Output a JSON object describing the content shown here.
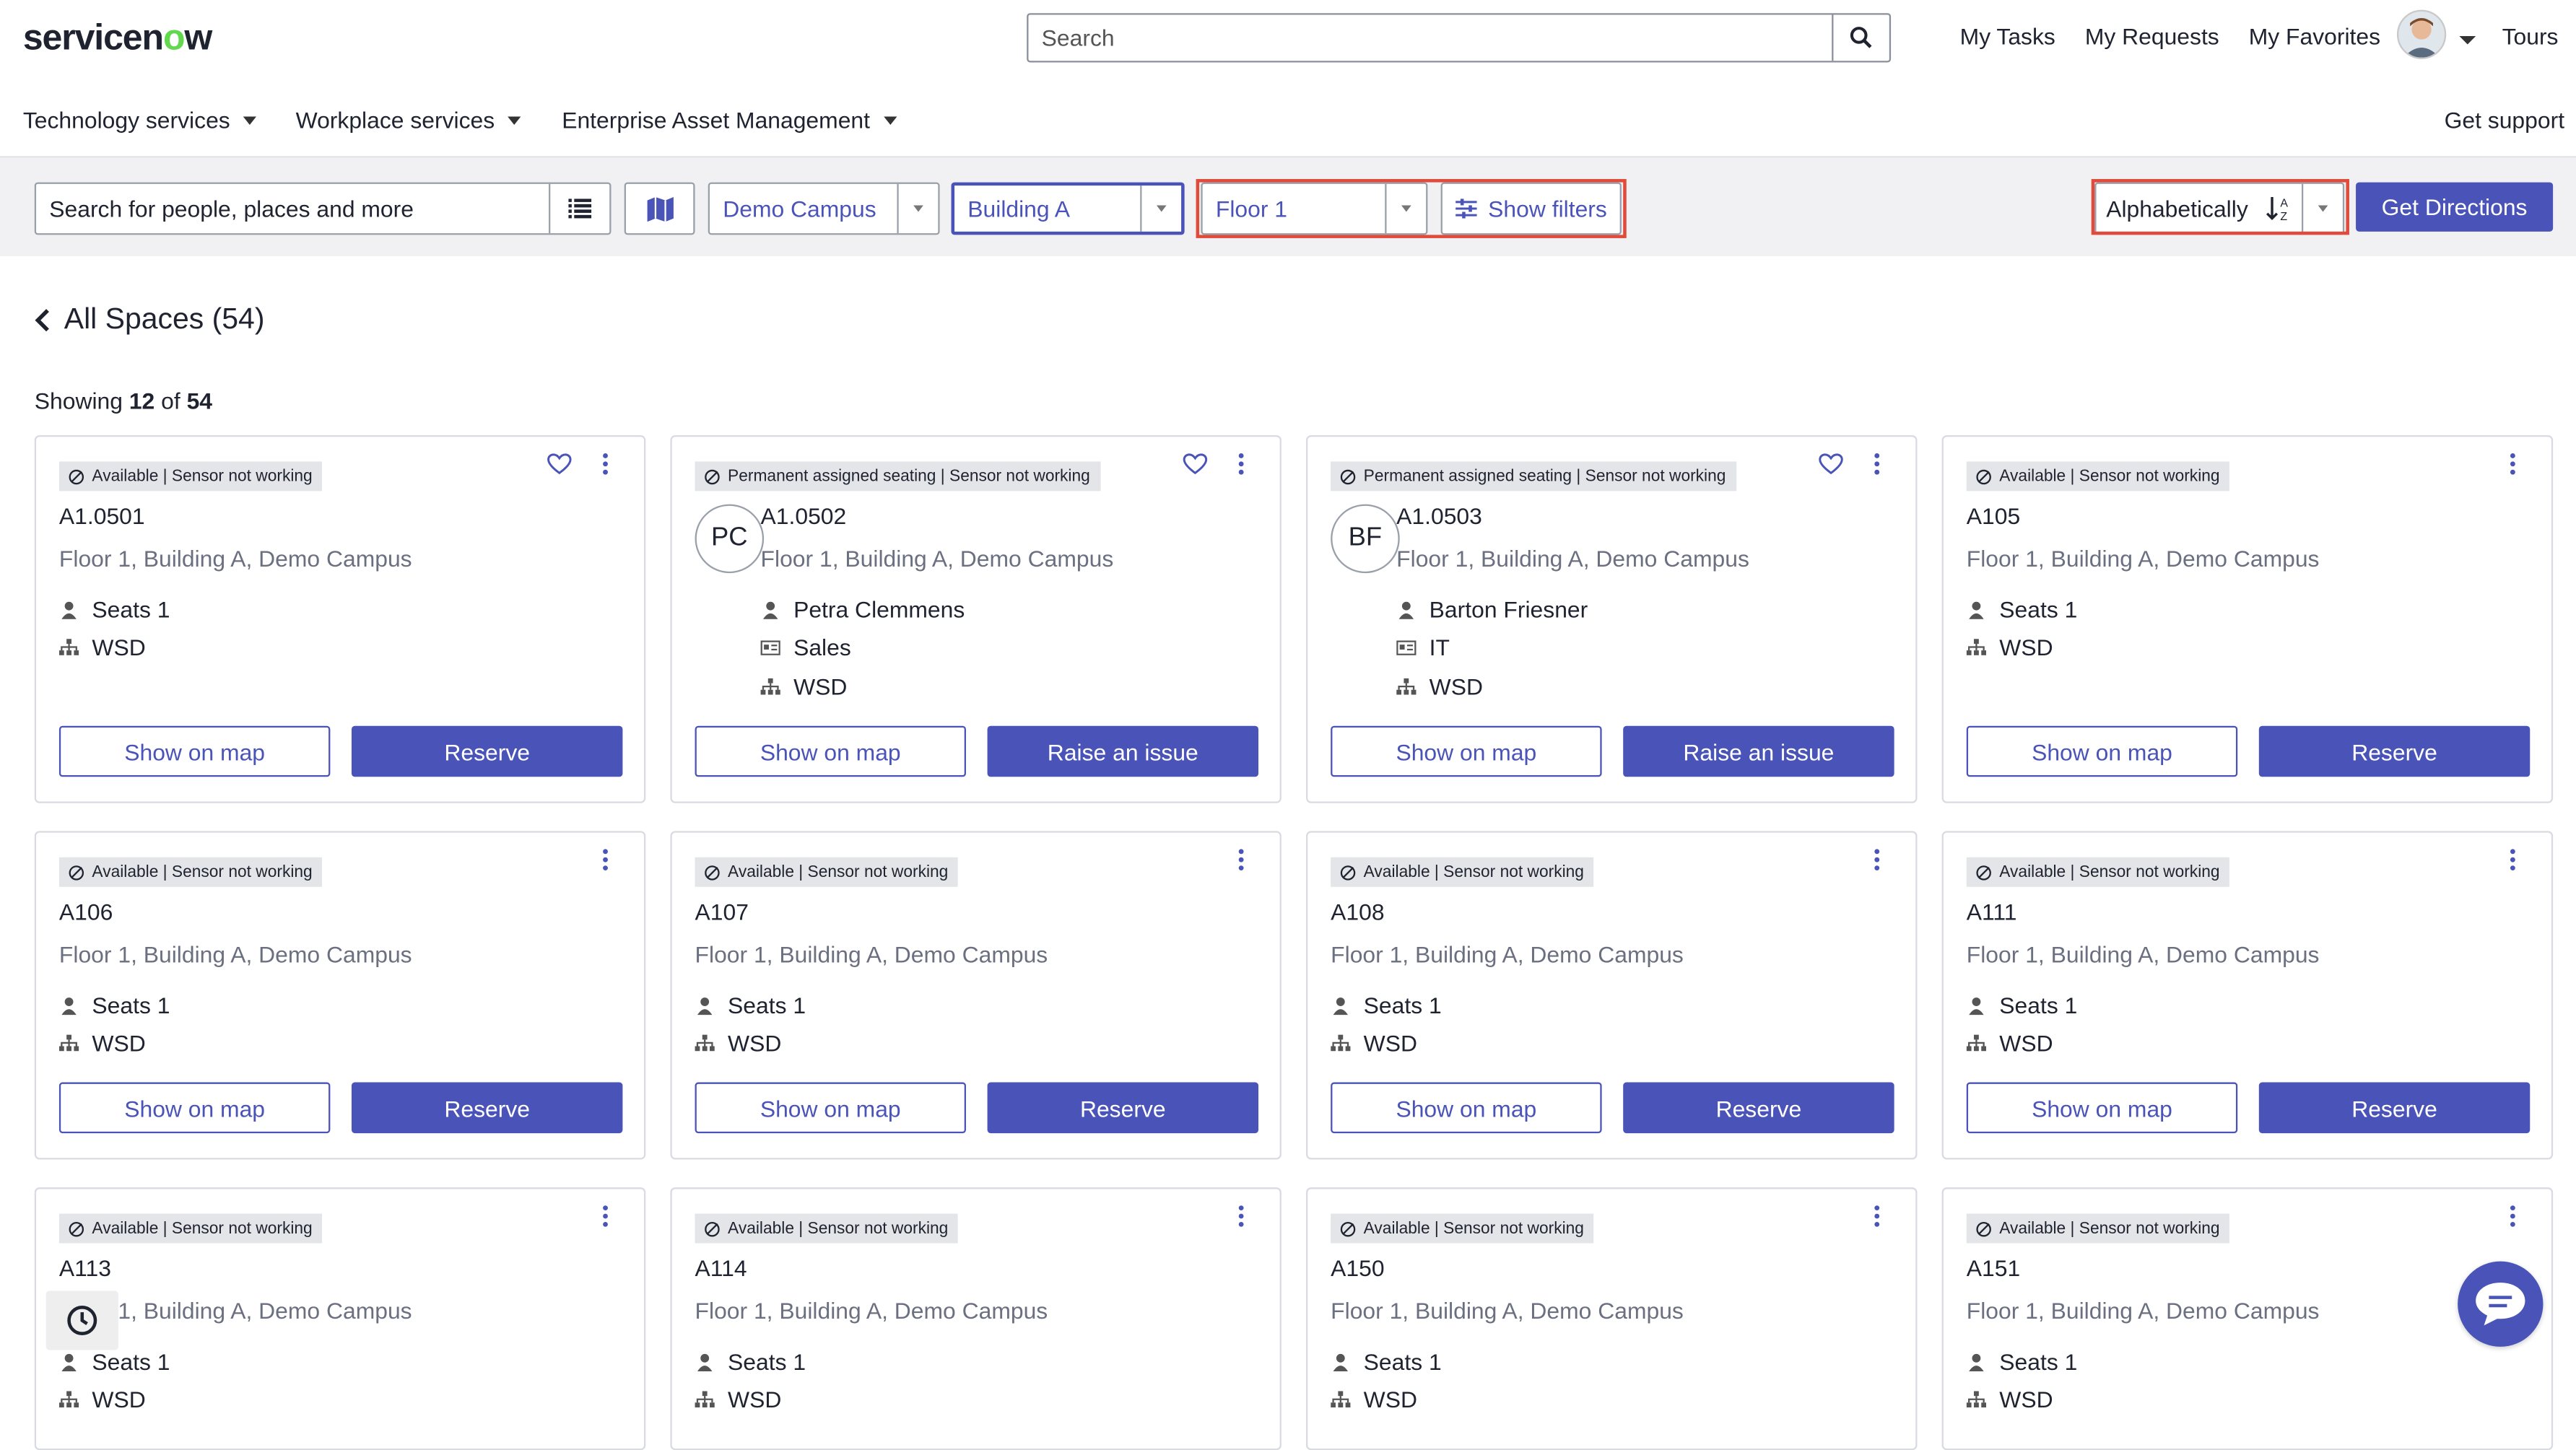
{
  "header": {
    "logo_a": "servicen",
    "logo_o": "o",
    "logo_b": "w",
    "search_placeholder": "Search",
    "links": [
      "My Tasks",
      "My Requests",
      "My Favorites"
    ],
    "tours": "Tours"
  },
  "nav": {
    "items": [
      "Technology services",
      "Workplace services",
      "Enterprise Asset Management"
    ],
    "support": "Get support"
  },
  "filters": {
    "search_placeholder": "Search for people, places and more",
    "campus": "Demo Campus",
    "building": "Building A",
    "floor": "Floor 1",
    "show_filters": "Show filters",
    "sort": "Alphabetically",
    "directions": "Get Directions"
  },
  "content": {
    "back_title": "All Spaces (54)",
    "showing_prefix": "Showing ",
    "showing_count": "12",
    "showing_mid": " of ",
    "showing_total": "54"
  },
  "labels": {
    "show_on_map": "Show on map",
    "reserve": "Reserve",
    "raise_issue": "Raise an issue"
  },
  "cards": [
    {
      "status": "Available | Sensor not working",
      "name": "A1.0501",
      "location": "Floor 1, Building A, Demo Campus",
      "seats": "Seats 1",
      "type": "WSD",
      "favorite": true
    },
    {
      "status": "Permanent assigned seating | Sensor not working",
      "name": "A1.0502",
      "location": "Floor 1, Building A, Demo Campus",
      "initials": "PC",
      "person": "Petra Clemmens",
      "department": "Sales",
      "type": "WSD",
      "favorite": true
    },
    {
      "status": "Permanent assigned seating | Sensor not working",
      "name": "A1.0503",
      "location": "Floor 1, Building A, Demo Campus",
      "initials": "BF",
      "person": "Barton Friesner",
      "department": "IT",
      "type": "WSD",
      "favorite": true
    },
    {
      "status": "Available | Sensor not working",
      "name": "A105",
      "location": "Floor 1, Building A, Demo Campus",
      "seats": "Seats 1",
      "type": "WSD"
    },
    {
      "status": "Available | Sensor not working",
      "name": "A106",
      "location": "Floor 1, Building A, Demo Campus",
      "seats": "Seats 1",
      "type": "WSD"
    },
    {
      "status": "Available | Sensor not working",
      "name": "A107",
      "location": "Floor 1, Building A, Demo Campus",
      "seats": "Seats 1",
      "type": "WSD"
    },
    {
      "status": "Available | Sensor not working",
      "name": "A108",
      "location": "Floor 1, Building A, Demo Campus",
      "seats": "Seats 1",
      "type": "WSD"
    },
    {
      "status": "Available | Sensor not working",
      "name": "A111",
      "location": "Floor 1, Building A, Demo Campus",
      "seats": "Seats 1",
      "type": "WSD"
    },
    {
      "status": "Available | Sensor not working",
      "name": "A113",
      "location": "Floor 1, Building A, Demo Campus",
      "seats": "Seats 1",
      "type": "WSD"
    },
    {
      "status": "Available | Sensor not working",
      "name": "A114",
      "location": "Floor 1, Building A, Demo Campus",
      "seats": "Seats 1",
      "type": "WSD"
    },
    {
      "status": "Available | Sensor not working",
      "name": "A150",
      "location": "Floor 1, Building A, Demo Campus",
      "seats": "Seats 1",
      "type": "WSD"
    },
    {
      "status": "Available | Sensor not working",
      "name": "A151",
      "location": "Floor 1, Building A, Demo Campus",
      "seats": "Seats 1",
      "type": "WSD"
    }
  ]
}
